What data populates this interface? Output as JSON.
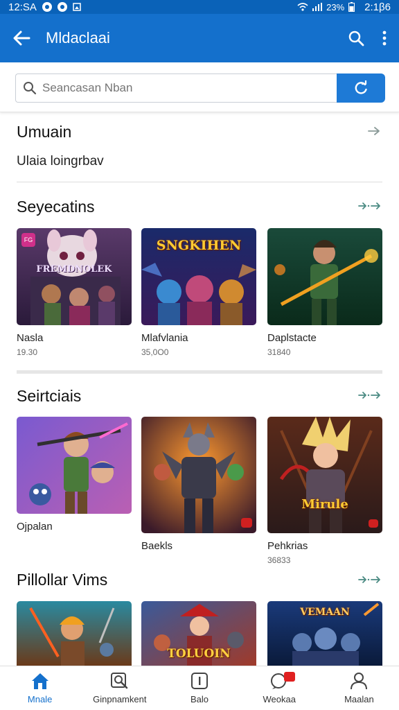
{
  "status_bar": {
    "time_left": "12:SA",
    "battery": "23%",
    "time_right": "2:1β6"
  },
  "app_bar": {
    "title": "Mldaclaai"
  },
  "search": {
    "placeholder": "Seancasan Nban"
  },
  "umuain": {
    "title": "Umuain",
    "subtitle": "Ulaia loingrbav",
    "arrow": "->"
  },
  "sections": [
    {
      "title": "Seyecatins",
      "arrow": "->->",
      "items": [
        {
          "name": "Nasla",
          "count": "19.30",
          "art": "FREMDNOLEK",
          "badge": "FG"
        },
        {
          "name": "Mlafvlania",
          "count": "35,0O0",
          "art": "SNGKIHEN"
        },
        {
          "name": "Daplstacte",
          "count": "31840"
        }
      ]
    },
    {
      "title": "Seirtciais",
      "arrow": "->->",
      "items": [
        {
          "name": "Ojpalan",
          "count": ""
        },
        {
          "name": "Baekls",
          "count": ""
        },
        {
          "name": "Pehkrias",
          "count": "36833",
          "art": "Mirule"
        }
      ]
    },
    {
      "title": "Pillollar Vims",
      "arrow": "->->",
      "items": [
        {
          "name": "",
          "count": ""
        },
        {
          "name": "",
          "count": "",
          "art": "TOLUOIN"
        },
        {
          "name": "",
          "count": "",
          "art": "VEMAAN"
        }
      ]
    }
  ],
  "tabs": [
    {
      "label": "Mnale",
      "icon": "home-icon"
    },
    {
      "label": "Ginpnamkent",
      "icon": "search-doc-icon"
    },
    {
      "label": "Balo",
      "icon": "info-icon"
    },
    {
      "label": "Weokaa",
      "icon": "chat-icon"
    },
    {
      "label": "Maalan",
      "icon": "profile-icon"
    }
  ],
  "colors": {
    "primary": "#1470cc",
    "status": "#0a62b8",
    "accent_arrow": "#4a8a82"
  }
}
